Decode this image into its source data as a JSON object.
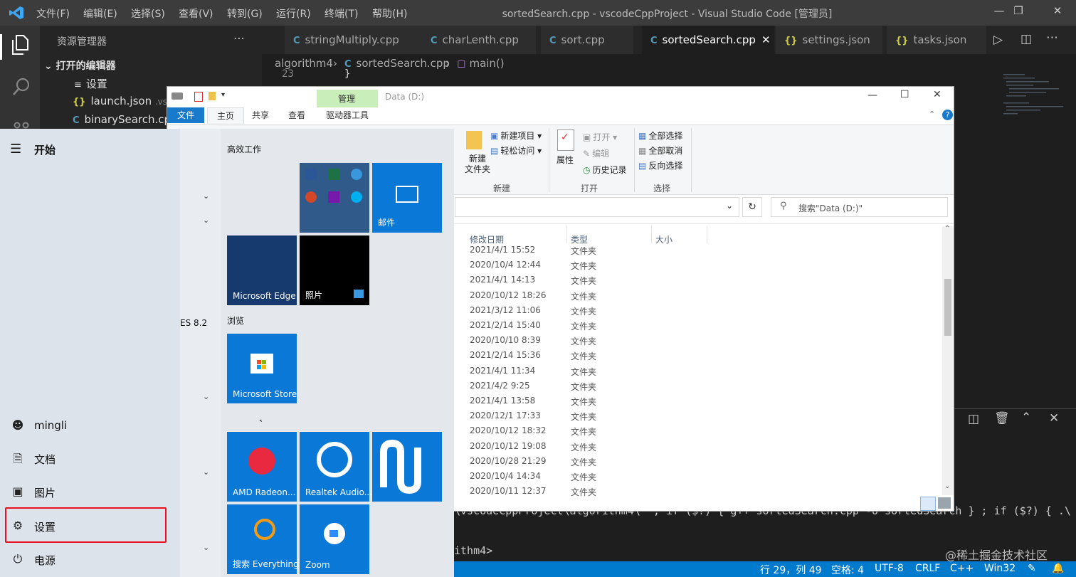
{
  "vscode": {
    "menu": [
      "文件(F)",
      "编辑(E)",
      "选择(S)",
      "查看(V)",
      "转到(G)",
      "运行(R)",
      "终端(T)",
      "帮助(H)"
    ],
    "window_title": "sortedSearch.cpp - vscodeCppProject - Visual Studio Code [管理员]",
    "explorer_title": "资源管理器",
    "open_editors_label": "打开的编辑器",
    "open_editors": [
      {
        "label": "设置",
        "suffix": ""
      },
      {
        "label": "launch.json",
        "suffix": ".vsco"
      },
      {
        "label": "binarySearch.cpp",
        "suffix": ""
      }
    ],
    "tabs": [
      "stringMultiply.cpp",
      "charLenth.cpp",
      "sort.cpp",
      "sortedSearch.cpp",
      "settings.json",
      "tasks.json"
    ],
    "active_tab": "sortedSearch.cpp",
    "breadcrumb": [
      "algorithm4",
      "sortedSearch.cpp",
      "main()"
    ],
    "line_number": "23",
    "code_line": "}",
    "terminal_cmd": "\\vscodeCppProject\\algorithm4\\\" ; if ($?) { g++ sortedSearch.cpp -o sortedSearch } ; if ($?) { .\\",
    "terminal_prompt": "ithm4>",
    "status": [
      "行 29，列 49",
      "空格: 4",
      "UTF-8",
      "CRLF",
      "C++",
      "Win32"
    ],
    "watermark": "@稀土掘金技术社区"
  },
  "explorer": {
    "manage_tab": "管理",
    "drive_tools_tab": "驱动器工具",
    "title": "Data (D:)",
    "ribbon_tabs": [
      "文件",
      "主页",
      "共享",
      "查看"
    ],
    "ribbon": {
      "new_folder": "新建\n文件夹",
      "new_item": "新建项目",
      "easy_access": "轻松访问",
      "group_new": "新建",
      "properties": "属性",
      "open": "打开",
      "edit": "编辑",
      "history": "历史记录",
      "group_open": "打开",
      "select_all": "全部选择",
      "select_none": "全部取消",
      "invert_select": "反向选择",
      "group_select": "选择"
    },
    "search_placeholder": "搜索\"Data (D:)\"",
    "columns": [
      "修改日期",
      "类型",
      "大小"
    ],
    "rows": [
      {
        "date": "2021/4/1 15:52",
        "type": "文件夹"
      },
      {
        "date": "2020/10/4 12:44",
        "type": "文件夹"
      },
      {
        "date": "2021/4/1 14:13",
        "type": "文件夹"
      },
      {
        "date": "2020/10/12 18:26",
        "type": "文件夹"
      },
      {
        "date": "2021/3/12 11:06",
        "type": "文件夹"
      },
      {
        "date": "2021/2/14 15:40",
        "type": "文件夹"
      },
      {
        "date": "2020/10/10 8:39",
        "type": "文件夹"
      },
      {
        "date": "2021/2/14 15:36",
        "type": "文件夹"
      },
      {
        "date": "2021/4/1 11:34",
        "type": "文件夹"
      },
      {
        "date": "2021/4/2 9:25",
        "type": "文件夹"
      },
      {
        "date": "2021/4/1 13:58",
        "type": "文件夹"
      },
      {
        "date": "2020/12/1 17:33",
        "type": "文件夹"
      },
      {
        "date": "2020/10/12 18:32",
        "type": "文件夹"
      },
      {
        "date": "2020/10/12 19:08",
        "type": "文件夹"
      },
      {
        "date": "2020/10/28 21:29",
        "type": "文件夹"
      },
      {
        "date": "2020/10/4 14:34",
        "type": "文件夹"
      },
      {
        "date": "2020/10/11 12:37",
        "type": "文件夹"
      }
    ]
  },
  "start": {
    "title": "开始",
    "user": "mingli",
    "items": [
      "文档",
      "图片",
      "设置",
      "电源"
    ],
    "highlighted_item": "设置",
    "mid_fragment": "ES 8.2",
    "group1": "高效工作",
    "group2": "浏览",
    "group3_mark": "、",
    "tiles": {
      "mail": "邮件",
      "edge": "Microsoft Edge",
      "photos": "照片",
      "store": "Microsoft Store",
      "amd": "AMD Radeon...",
      "realtek": "Realtek Audio...",
      "everything": "搜索 Everything",
      "zoom": "Zoom"
    },
    "highlight_color": "#e81123"
  }
}
